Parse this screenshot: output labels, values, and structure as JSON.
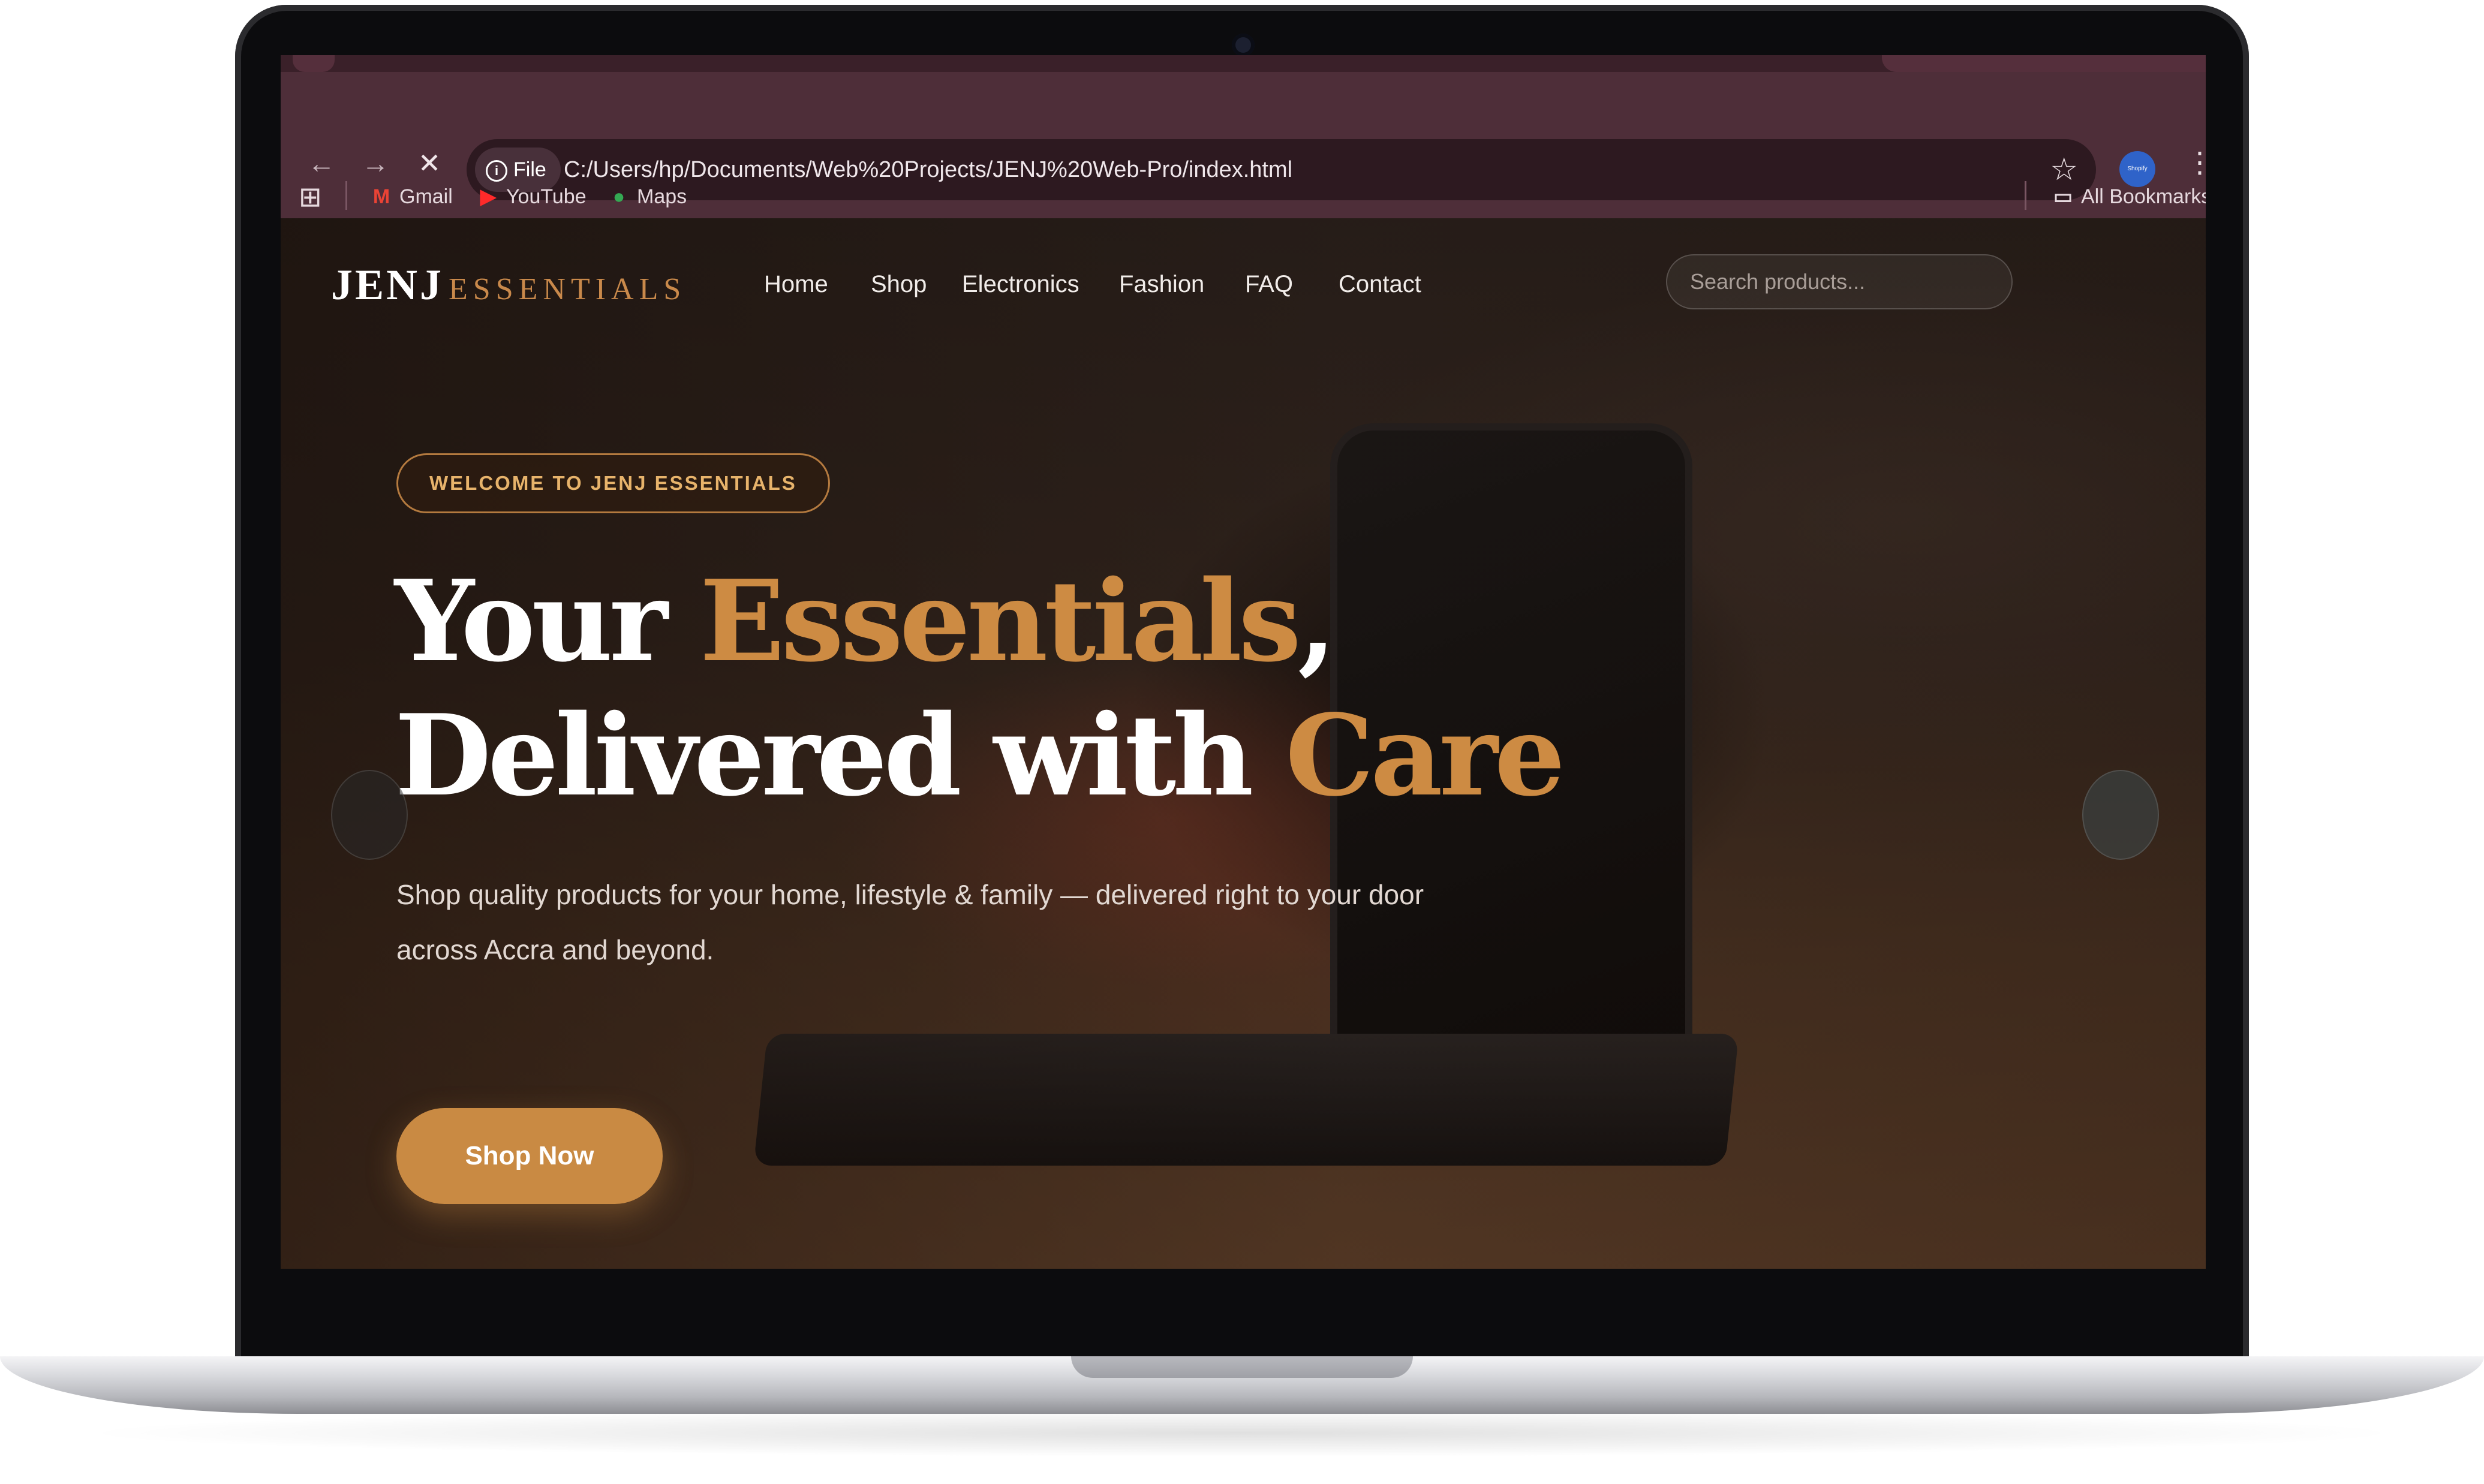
{
  "browser": {
    "address_chip": "File",
    "url": "C:/Users/hp/Documents/Web%20Projects/JENJ%20Web-Pro/index.html",
    "bookmarks": [
      {
        "label": "Gmail",
        "icon": "gmail-icon"
      },
      {
        "label": "YouTube",
        "icon": "youtube-icon"
      },
      {
        "label": "Maps",
        "icon": "maps-icon"
      }
    ],
    "all_bookmarks": "All Bookmarks",
    "profile_label": "Shopify"
  },
  "site": {
    "logo_main": "JENJ",
    "logo_sub": "ESSENTIALS",
    "nav": [
      "Home",
      "Shop",
      "Electronics",
      "Fashion",
      "FAQ",
      "Contact"
    ],
    "search_placeholder": "Search products..."
  },
  "hero": {
    "badge": "WELCOME TO JENJ ESSENTIALS",
    "headline": {
      "line1_a": "Your ",
      "line1_b": "Essentials",
      "line1_c": ",",
      "line2_a": "Delivered with ",
      "line2_b": "Care"
    },
    "lede": "Shop quality products for your home, lifestyle & family — delivered right to your door across Accra and beyond.",
    "cta": "Shop Now"
  },
  "colors": {
    "accent": "#cd8b43",
    "chrome": "#4e2e39"
  }
}
